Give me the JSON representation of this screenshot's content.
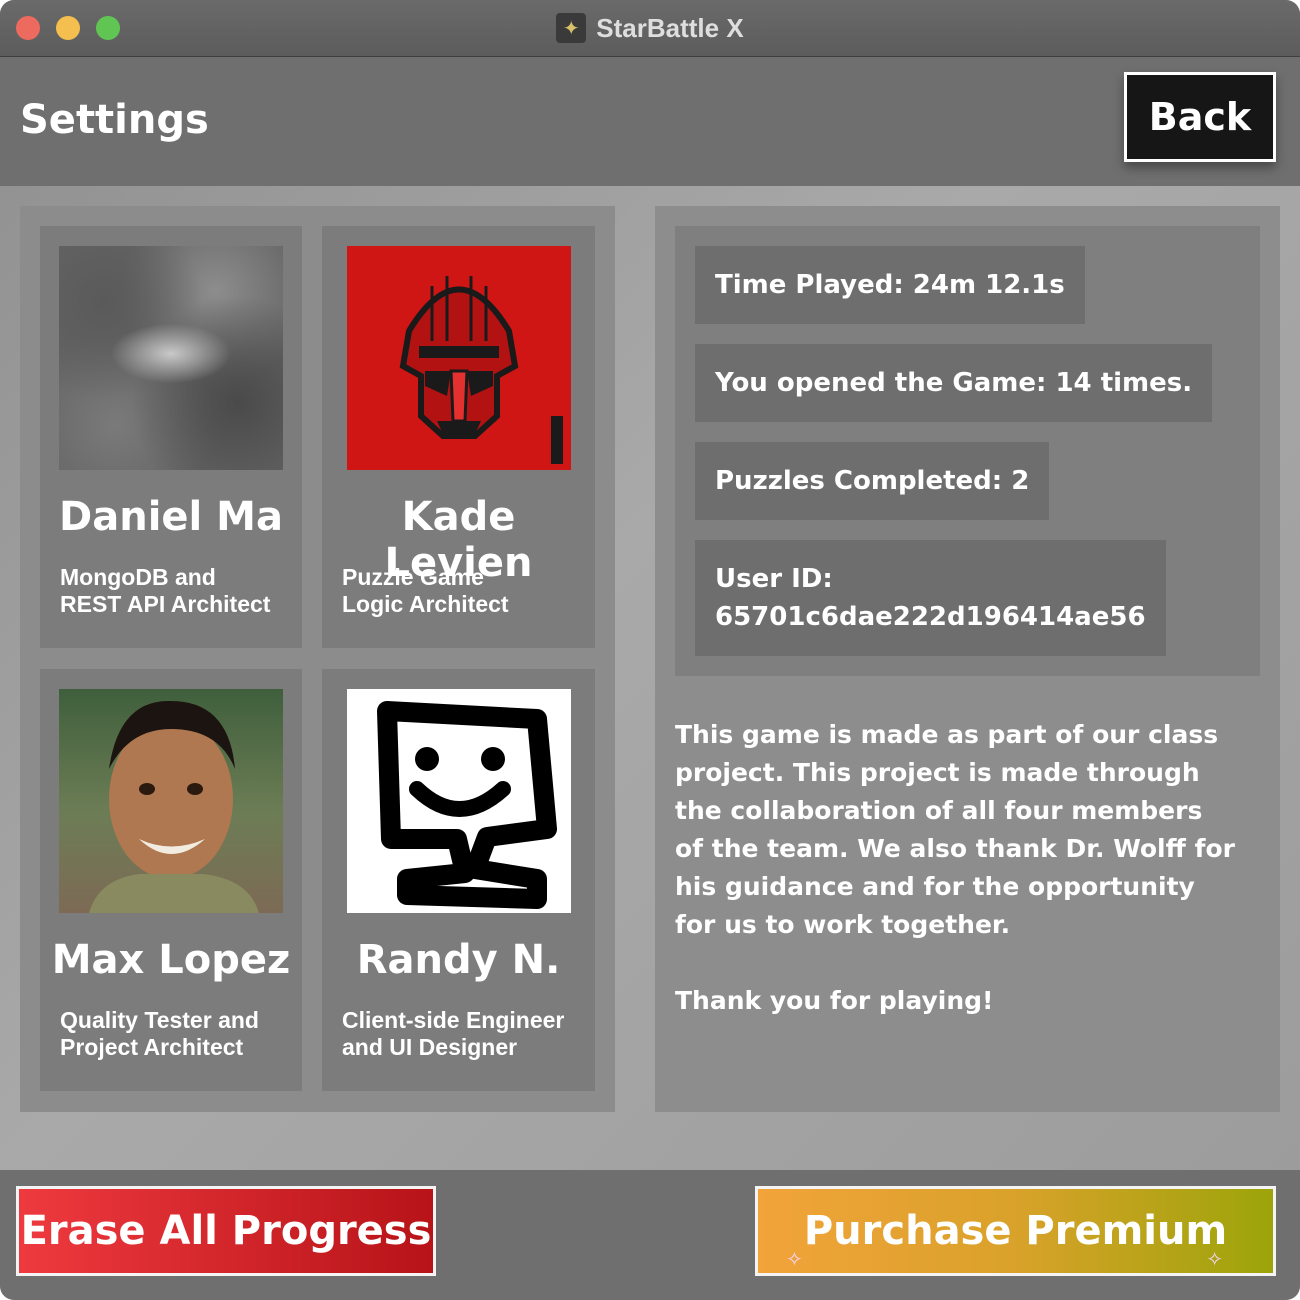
{
  "window": {
    "title": "StarBattle X"
  },
  "header": {
    "title": "Settings",
    "back_label": "Back"
  },
  "team": [
    {
      "name": "Daniel Ma",
      "role_line1": "MongoDB and",
      "role_line2": "REST API Architect"
    },
    {
      "name": "Kade Levien",
      "role_line1": "Puzzle Game",
      "role_line2": "Logic Architect"
    },
    {
      "name": "Max Lopez",
      "role_line1": "Quality Tester and",
      "role_line2": "Project Architect"
    },
    {
      "name": "Randy N.",
      "role_line1": "Client-side Engineer",
      "role_line2": "and UI Designer"
    }
  ],
  "stats": {
    "time_played": "Time Played: 24m 12.1s",
    "opened": "You opened the Game: 14 times.",
    "puzzles": "Puzzles Completed: 2",
    "user_id_label": "User ID:",
    "user_id_value": "65701c6dae222d196414ae56"
  },
  "about": {
    "text": "This game is made as part of our class project. This project is made through the collaboration of all four members of the team. We also thank Dr. Wolff for his guidance and for the opportunity for us to work together.",
    "thanks": "Thank you for playing!"
  },
  "footer": {
    "erase_label": "Erase All Progress",
    "premium_label": "Purchase Premium"
  },
  "colors": {
    "erase_start": "#ee3a3f",
    "erase_end": "#b71318",
    "premium_start": "#f2a33a",
    "premium_end": "#9ca40a"
  }
}
